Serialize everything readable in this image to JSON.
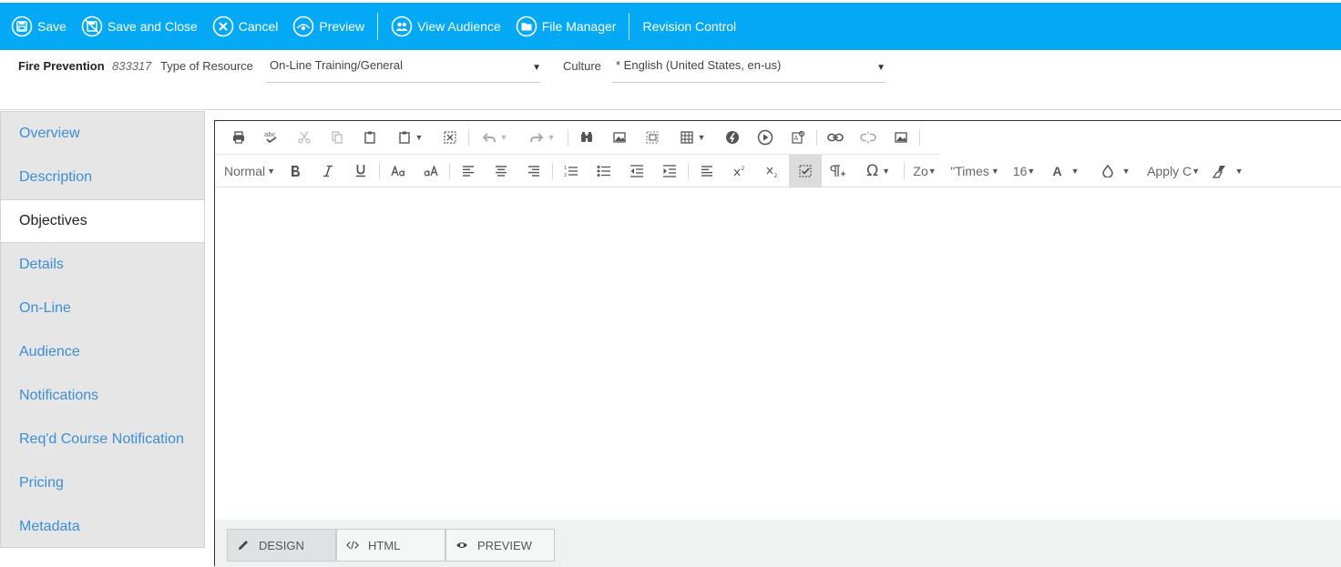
{
  "toolbar": {
    "save": "Save",
    "save_close": "Save and Close",
    "cancel": "Cancel",
    "preview": "Preview",
    "view_audience": "View Audience",
    "file_manager": "File Manager",
    "revision_control": "Revision Control"
  },
  "header": {
    "name": "Fire Prevention",
    "code": "833317",
    "type_label": "Type of Resource",
    "type_value": "On-Line Training/General",
    "culture_label": "Culture",
    "culture_value": "* English (United States, en-us)"
  },
  "sidebar": {
    "items": [
      {
        "label": "Overview"
      },
      {
        "label": "Description"
      },
      {
        "label": "Objectives"
      },
      {
        "label": "Details"
      },
      {
        "label": "On-Line"
      },
      {
        "label": "Audience"
      },
      {
        "label": "Notifications"
      },
      {
        "label": "Req'd Course Notification"
      },
      {
        "label": "Pricing"
      },
      {
        "label": "Metadata"
      }
    ],
    "active": "Objectives"
  },
  "editor": {
    "format_value": "Normal",
    "zoom_value": "Zo",
    "font_value": "\"Times",
    "size_value": "16",
    "css_value": "Apply C",
    "modes": {
      "design": "DESIGN",
      "html": "HTML",
      "preview": "PREVIEW"
    },
    "active_mode": "DESIGN"
  },
  "colors": {
    "toolbar_bg": "#03a9f4",
    "link": "#3a8fd8",
    "sidebar_bg": "#e6e6e6"
  }
}
